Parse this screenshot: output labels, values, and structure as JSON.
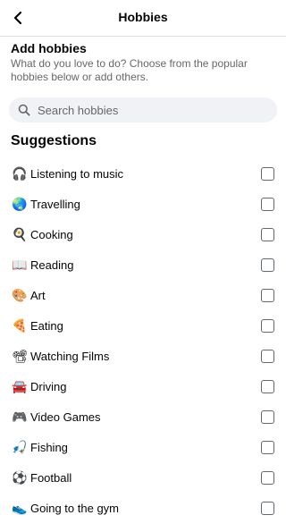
{
  "header": {
    "title": "Hobbies",
    "back_icon": "chevron-left-icon"
  },
  "intro": {
    "title": "Add hobbies",
    "subtitle": "What do you love to do? Choose from the popular hobbies below or add others."
  },
  "search": {
    "placeholder": "Search hobbies",
    "value": "",
    "icon": "search-icon"
  },
  "suggestions": {
    "title": "Suggestions",
    "items": [
      {
        "emoji": "🎧",
        "icon": "headphones-icon",
        "label": "Listening to music",
        "checked": false
      },
      {
        "emoji": "🌏",
        "icon": "globe-icon",
        "label": "Travelling",
        "checked": false
      },
      {
        "emoji": "🍳",
        "icon": "frying-pan-icon",
        "label": "Cooking",
        "checked": false
      },
      {
        "emoji": "📖",
        "icon": "open-book-icon",
        "label": "Reading",
        "checked": false
      },
      {
        "emoji": "🎨",
        "icon": "palette-icon",
        "label": "Art",
        "checked": false
      },
      {
        "emoji": "🍕",
        "icon": "pizza-icon",
        "label": "Eating",
        "checked": false
      },
      {
        "emoji": "📽",
        "icon": "film-projector-icon",
        "label": "Watching Films",
        "checked": false
      },
      {
        "emoji": "🚘",
        "icon": "car-icon",
        "label": "Driving",
        "checked": false
      },
      {
        "emoji": "🎮",
        "icon": "game-controller-icon",
        "label": "Video Games",
        "checked": false
      },
      {
        "emoji": "🎣",
        "icon": "fishing-pole-icon",
        "label": "Fishing",
        "checked": false
      },
      {
        "emoji": "⚽",
        "icon": "soccer-ball-icon",
        "label": "Football",
        "checked": false
      },
      {
        "emoji": "👟",
        "icon": "running-shoe-icon",
        "label": "Going to the gym",
        "checked": false
      }
    ]
  }
}
